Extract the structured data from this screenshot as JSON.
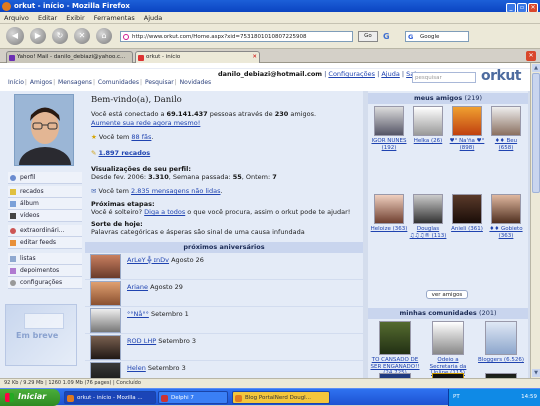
{
  "window": {
    "title": "orkut - início - Mozilla Firefox"
  },
  "menu": [
    "Arquivo",
    "Editar",
    "Exibir",
    "Ferramentas",
    "Ajuda"
  ],
  "nav": {
    "url": "http://www.orkut.com/Home.aspx?xid=7531801010807225908",
    "go_label": "Go",
    "search_placeholder": "Google"
  },
  "tabs": [
    {
      "label": "Yahoo! Mail - danilo_debiazi@yahoo.c...",
      "active": false
    },
    {
      "label": "orkut - início",
      "active": true
    }
  ],
  "orkut": {
    "nav_links": [
      "Início",
      "Amigos",
      "Mensagens",
      "Comunidades",
      "Pesquisar",
      "Novidades"
    ],
    "user_email": "danilo_debiazi@hotmail.com",
    "user_links": [
      "Configurações",
      "Ajuda",
      "Sair"
    ],
    "search_placeholder": "pesquisar",
    "logo": "orkut"
  },
  "sidebar": [
    {
      "label": "perfil",
      "icon": "profile-icon"
    },
    {
      "label": "recados",
      "icon": "scraps-icon"
    },
    {
      "label": "álbum",
      "icon": "album-icon"
    },
    {
      "label": "vídeos",
      "icon": "videos-icon"
    },
    {
      "label": "extraordinári...",
      "icon": "app-icon"
    },
    {
      "label": "editar feeds",
      "icon": "feeds-icon"
    },
    {
      "label": "listas",
      "icon": "lists-icon"
    },
    {
      "label": "depoimentos",
      "icon": "testimonials-icon"
    },
    {
      "label": "configurações",
      "icon": "settings-icon"
    }
  ],
  "sidebar_promo": "Em breve",
  "main": {
    "welcome": "Bem-vindo(a), Danilo",
    "connected_pre": "Você está conectado a ",
    "connected_count": "69.141.437",
    "connected_mid": " pessoas através de ",
    "connected_friends": "230",
    "connected_post": " amigos.",
    "expand_link": "Aumente sua rede agora mesmo!",
    "fans_pre": "Você tem ",
    "fans_link": "88 fãs",
    "fans_post": ".",
    "recados_link": "1.897 recados",
    "views_title": "Visualizações de seu perfil:",
    "views_pre": "Desde fev. 2006: ",
    "views_total": "3.310",
    "views_mid": ", Semana passada: ",
    "views_week": "55",
    "views_mid2": ", Ontem: ",
    "views_yesterday": "7",
    "unread_pre": "Você tem ",
    "unread_link": "2.835 mensagens não lidas",
    "unread_post": ".",
    "next_steps_title": "Próximas etapas:",
    "next_steps_pre": "Você é solteiro? ",
    "next_steps_link": "Diga a todos",
    "next_steps_post": " o que você procura, assim o orkut pode te ajudar!",
    "luck_title": "Sorte de hoje:",
    "luck_text": "Palavras categóricas e ásperas são sinal de uma causa infundada"
  },
  "birthdays": {
    "title": "próximos aniversários",
    "items": [
      {
        "name": "ArLeY ╬ ɪnDv",
        "date": "Agosto 26"
      },
      {
        "name": "Ariane",
        "date": "Agosto 29"
      },
      {
        "name": "°°Nå°°",
        "date": "Setembro 1"
      },
      {
        "name": "ROD LHP",
        "date": "Setembro 3"
      },
      {
        "name": "Helen",
        "date": "Setembro 3"
      }
    ]
  },
  "friends": {
    "title": "meus amigos",
    "count": "(219)",
    "items": [
      {
        "name": "IGOR NUNES (192)"
      },
      {
        "name": "Heīka (26)"
      },
      {
        "name": "♥° Na'ña ♥° (898)"
      },
      {
        "name": "♦♦ Beu (658)"
      },
      {
        "name": "Heloize (363)"
      },
      {
        "name": "Douglas ♫♫♫® (113)"
      },
      {
        "name": "Anieli (361)"
      },
      {
        "name": "♦♦ Gobieto (363)"
      }
    ],
    "see_all": "ver amigos"
  },
  "communities": {
    "title": "minhas comunidades",
    "count": "(201)",
    "items": [
      {
        "name": "TO CANSADO DE SER ENGANADO!! (24.725)"
      },
      {
        "name": "Odeio a Secretaria da Unline (115)"
      },
      {
        "name": "Bloggers (6.526)"
      },
      {
        "name": ""
      },
      {
        "name": ""
      },
      {
        "name": ""
      }
    ]
  },
  "statusbar": {
    "text": "92 Kb / 9.29 Mb | 1260 1.09 Mb (76 pages) | Concluído"
  },
  "taskbar": {
    "start": "Iniciar",
    "items": [
      {
        "label": "orkut - início - Mozilla ...",
        "active": true
      },
      {
        "label": "Delphi 7",
        "active": false
      },
      {
        "label": "Blog PortalNerd Dougl...",
        "active": false
      }
    ],
    "lang": "PT",
    "clock": "14:59"
  }
}
